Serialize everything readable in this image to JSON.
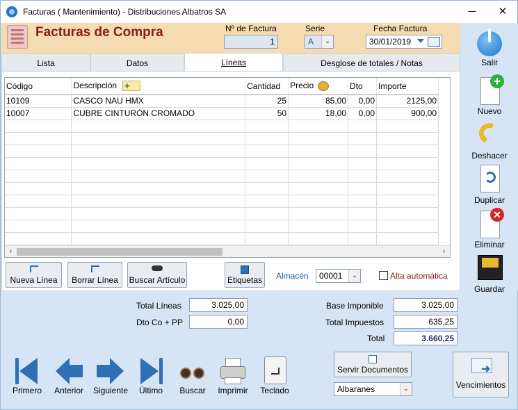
{
  "window": {
    "title": "Facturas ( Mantenimiento) - Distribuciones Albatros SA",
    "minimize": "─",
    "close": "✕"
  },
  "header": {
    "page_title": "Facturas de Compra",
    "invoice_number_label": "Nº de Factura",
    "invoice_number": "1",
    "series_label": "Serie",
    "series": "A",
    "date_label": "Fecha Factura",
    "date": "30/01/2019"
  },
  "tabs": [
    "Lista",
    "Datos",
    "Líneas",
    "Desglose de totales / Notas"
  ],
  "active_tab": "Líneas",
  "grid": {
    "columns": [
      "Código",
      "Descripción",
      "Cantidad",
      "Precio",
      "Dto",
      "Importe"
    ],
    "rows": [
      [
        "10109",
        "CASCO NAU HMX",
        "25",
        "85,00",
        "0,00",
        "2125,00"
      ],
      [
        "10007",
        "CUBRE CINTURÓN CROMADO",
        "50",
        "18,00",
        "0,00",
        "900,00"
      ]
    ],
    "empty_rows": 10
  },
  "line_buttons": {
    "new_line": "Nueva Línea",
    "delete_line": "Borrar Línea",
    "find_item": "Buscar Artículo",
    "labels": "Etiquetas"
  },
  "warehouse": {
    "label": "Almacén",
    "value": "00001"
  },
  "auto_add": {
    "label": "Alta automática",
    "checked": false
  },
  "totals": {
    "total_lines_label": "Total Líneas",
    "total_lines": "3.025,00",
    "discount_label": "Dto Co + PP",
    "discount": "0,00",
    "tax_base_label": "Base Imponible",
    "tax_base": "3.025,00",
    "total_taxes_label": "Total Impuestos",
    "total_taxes": "635,25",
    "total_label": "Total",
    "total": "3.660,25"
  },
  "sidebar": {
    "exit": "Salir",
    "new": "Nuevo",
    "undo": "Deshacer",
    "duplicate": "Duplicar",
    "delete": "Eliminar",
    "save": "Guardar"
  },
  "nav": {
    "first": "Primero",
    "previous": "Anterior",
    "next": "Siguiente",
    "last": "Último",
    "search": "Buscar",
    "print": "Imprimir",
    "keyboard": "Teclado"
  },
  "serve_docs": {
    "label": "Servir Documentos",
    "select_value": "Albaranes"
  },
  "due_dates": "Vencimientos",
  "colors": {
    "accent": "#8b1a1a",
    "header_bg": "#f5dcb0",
    "window_bg": "#d5e5f6",
    "nav_blue": "#2f6fb5"
  }
}
